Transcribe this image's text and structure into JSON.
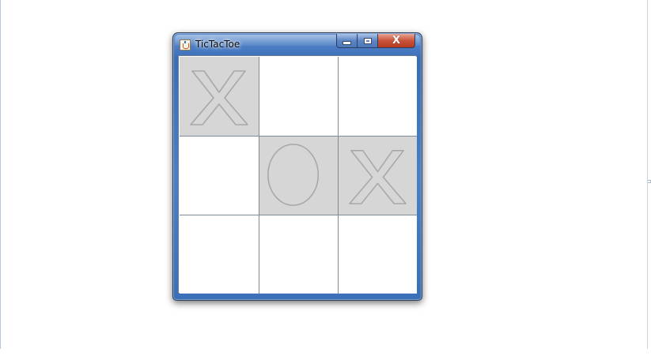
{
  "window": {
    "title": "TicTacToe",
    "icon": "java-cup-icon",
    "buttons": {
      "minimize_icon": "minimize-icon",
      "maximize_icon": "maximize-icon",
      "close_label": "X"
    },
    "colors": {
      "frame": "#3a6db8",
      "close": "#c8523a"
    }
  },
  "board": {
    "cells": [
      {
        "mark": "X"
      },
      {
        "mark": ""
      },
      {
        "mark": ""
      },
      {
        "mark": ""
      },
      {
        "mark": "O"
      },
      {
        "mark": "X"
      },
      {
        "mark": ""
      },
      {
        "mark": ""
      },
      {
        "mark": ""
      }
    ],
    "colors": {
      "filled_cell": "#d6d6d6",
      "empty_cell": "#ffffff",
      "mark_outline": "#a8a8a8",
      "grid_line": "#7f8a94"
    }
  }
}
